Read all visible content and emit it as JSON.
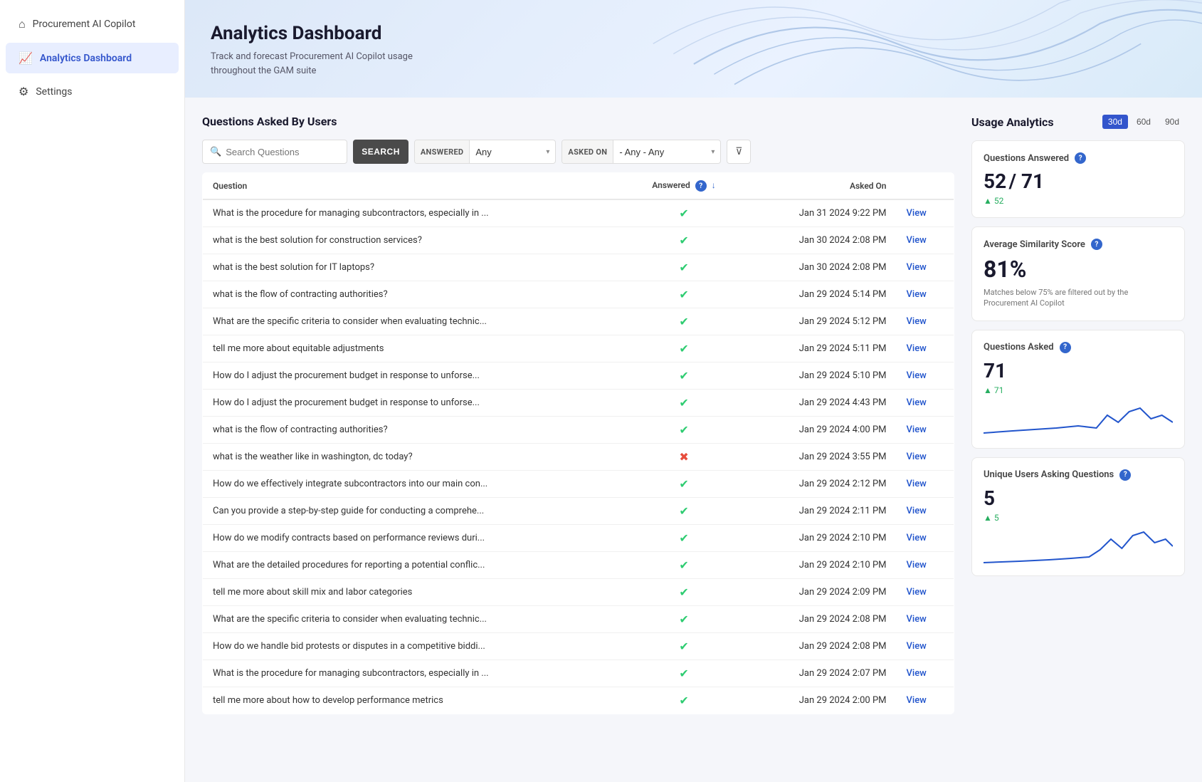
{
  "sidebar": {
    "items": [
      {
        "id": "procurement",
        "label": "Procurement AI Copilot",
        "icon": "⌂",
        "active": false
      },
      {
        "id": "analytics",
        "label": "Analytics Dashboard",
        "icon": "📈",
        "active": true
      },
      {
        "id": "settings",
        "label": "Settings",
        "icon": "⚙",
        "active": false
      }
    ]
  },
  "header": {
    "title": "Analytics Dashboard",
    "subtitle_line1": "Track and forecast Procurement AI Copilot usage",
    "subtitle_line2": "throughout the GAM suite"
  },
  "questions_section": {
    "title": "Questions Asked By Users",
    "search_placeholder": "Search Questions",
    "search_button": "SEARCH",
    "filter_answered_label": "ANSWERED",
    "filter_answered_value": "Any",
    "filter_askedon_label": "ASKED ON",
    "filter_askedon_value": "- Any - Any",
    "columns": {
      "question": "Question",
      "answered": "Answered",
      "asked_on": "Asked On"
    },
    "rows": [
      {
        "question": "What is the procedure for managing subcontractors, especially in ...",
        "answered": true,
        "asked_on": "Jan 31 2024 9:22 PM"
      },
      {
        "question": "what is the best solution for construction services?",
        "answered": true,
        "asked_on": "Jan 30 2024 2:08 PM"
      },
      {
        "question": "what is the best solution for IT laptops?",
        "answered": true,
        "asked_on": "Jan 30 2024 2:08 PM"
      },
      {
        "question": "what is the flow of contracting authorities?",
        "answered": true,
        "asked_on": "Jan 29 2024 5:14 PM"
      },
      {
        "question": "What are the specific criteria to consider when evaluating technic...",
        "answered": true,
        "asked_on": "Jan 29 2024 5:12 PM"
      },
      {
        "question": "tell me more about equitable adjustments",
        "answered": true,
        "asked_on": "Jan 29 2024 5:11 PM"
      },
      {
        "question": "How do I adjust the procurement budget in response to unforse...",
        "answered": true,
        "asked_on": "Jan 29 2024 5:10 PM"
      },
      {
        "question": "How do I adjust the procurement budget in response to unforse...",
        "answered": true,
        "asked_on": "Jan 29 2024 4:43 PM"
      },
      {
        "question": "what is the flow of contracting authorities?",
        "answered": true,
        "asked_on": "Jan 29 2024 4:00 PM"
      },
      {
        "question": "what is the weather like in washington, dc today?",
        "answered": false,
        "asked_on": "Jan 29 2024 3:55 PM"
      },
      {
        "question": "How do we effectively integrate subcontractors into our main con...",
        "answered": true,
        "asked_on": "Jan 29 2024 2:12 PM"
      },
      {
        "question": "Can you provide a step-by-step guide for conducting a comprehe...",
        "answered": true,
        "asked_on": "Jan 29 2024 2:11 PM"
      },
      {
        "question": "How do we modify contracts based on performance reviews duri...",
        "answered": true,
        "asked_on": "Jan 29 2024 2:10 PM"
      },
      {
        "question": "What are the detailed procedures for reporting a potential conflic...",
        "answered": true,
        "asked_on": "Jan 29 2024 2:10 PM"
      },
      {
        "question": "tell me more about skill mix and labor categories",
        "answered": true,
        "asked_on": "Jan 29 2024 2:09 PM"
      },
      {
        "question": "What are the specific criteria to consider when evaluating technic...",
        "answered": true,
        "asked_on": "Jan 29 2024 2:08 PM"
      },
      {
        "question": "How do we handle bid protests or disputes in a competitive biddi...",
        "answered": true,
        "asked_on": "Jan 29 2024 2:08 PM"
      },
      {
        "question": "What is the procedure for managing subcontractors, especially in ...",
        "answered": true,
        "asked_on": "Jan 29 2024 2:07 PM"
      },
      {
        "question": "tell me more about how to develop performance metrics",
        "answered": true,
        "asked_on": "Jan 29 2024 2:00 PM"
      }
    ]
  },
  "analytics": {
    "title": "Usage Analytics",
    "time_buttons": [
      "30d",
      "60d",
      "90d"
    ],
    "active_time": "30d",
    "cards": {
      "questions_answered": {
        "title": "Questions Answered",
        "value": "52",
        "denominator": "/ 71",
        "delta": "52"
      },
      "avg_similarity": {
        "title": "Average Similarity Score",
        "value": "81%",
        "note": "Matches below 75% are filtered out by the Procurement AI Copilot"
      },
      "questions_asked": {
        "title": "Questions Asked",
        "value": "71",
        "delta": "71"
      },
      "unique_users": {
        "title": "Unique Users Asking Questions",
        "value": "5",
        "delta": "5"
      }
    }
  }
}
